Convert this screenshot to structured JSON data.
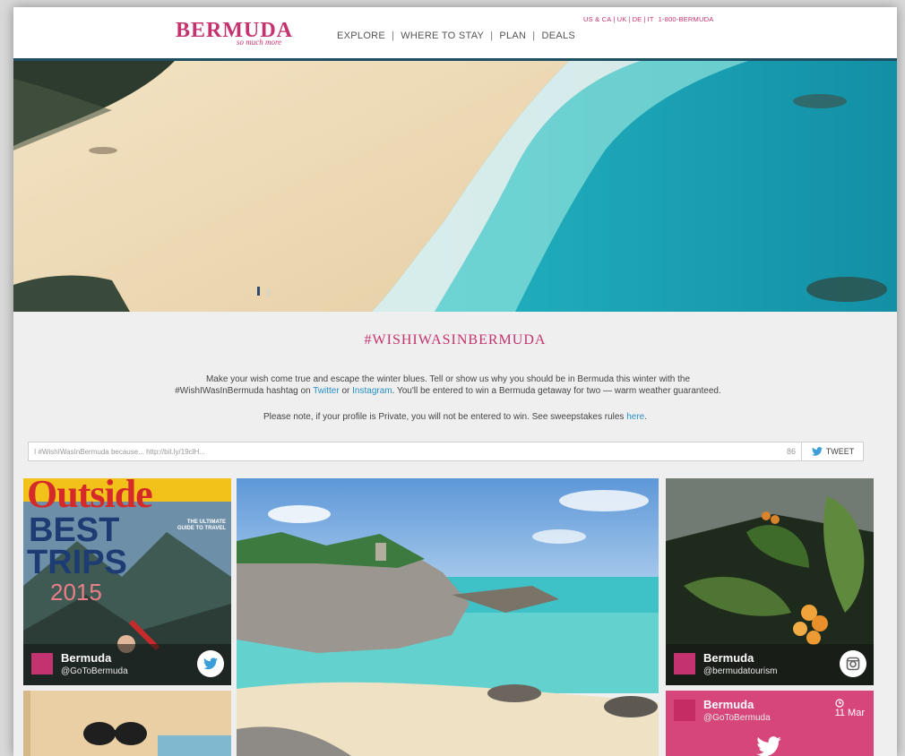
{
  "header": {
    "logo": {
      "wordmark": "BERMUDA",
      "tagline": "so much more"
    },
    "nav": [
      "EXPLORE",
      "WHERE TO STAY",
      "PLAN",
      "DEALS"
    ],
    "utility": [
      "US & CA",
      "UK",
      "DE",
      "IT",
      "1-800-BERMUDA"
    ]
  },
  "campaign": {
    "title": "#WISHIWASINBERMUDA",
    "intro_before_twitter": "Make your wish come true and escape the winter blues. Tell or show us why you should be in Bermuda this winter with the #WishIWasInBermuda hashtag on ",
    "twitter_link": "Twitter",
    "intro_or": " or ",
    "instagram_link": "Instagram",
    "intro_after": ". You'll be entered to win a Bermuda getaway for two — warm weather guaranteed.",
    "rules_text": "Please note, if your profile is Private, you will not be entered to win. See sweepstakes rules ",
    "rules_link": "here",
    "rules_end": "."
  },
  "tweet_bar": {
    "value": "I #WishIWasInBermuda because... http://bit.ly/19clH...",
    "char_count": "86",
    "button_label": "TWEET"
  },
  "feed": {
    "magazine_cover": {
      "masthead": "Outside",
      "headline_1": "BEST",
      "headline_2": "TRIPS",
      "year": "2015",
      "sidebar_heading": "THE ULTIMATE GUIDE TO TRAVEL"
    },
    "tiles": [
      {
        "name": "Bermuda",
        "handle": "@GoToBermuda",
        "network": "twitter"
      },
      {
        "name": "Bermuda",
        "handle": "@bermudatourism",
        "network": "instagram"
      },
      {
        "name": "Bermuda",
        "handle": "@GoToBermuda",
        "network": "twitter",
        "date": "11 Mar"
      }
    ]
  },
  "colors": {
    "brand_pink": "#c4336f",
    "link_blue": "#2a90c6",
    "header_rule": "#1f4f62",
    "tile_pink": "#d7467a"
  }
}
